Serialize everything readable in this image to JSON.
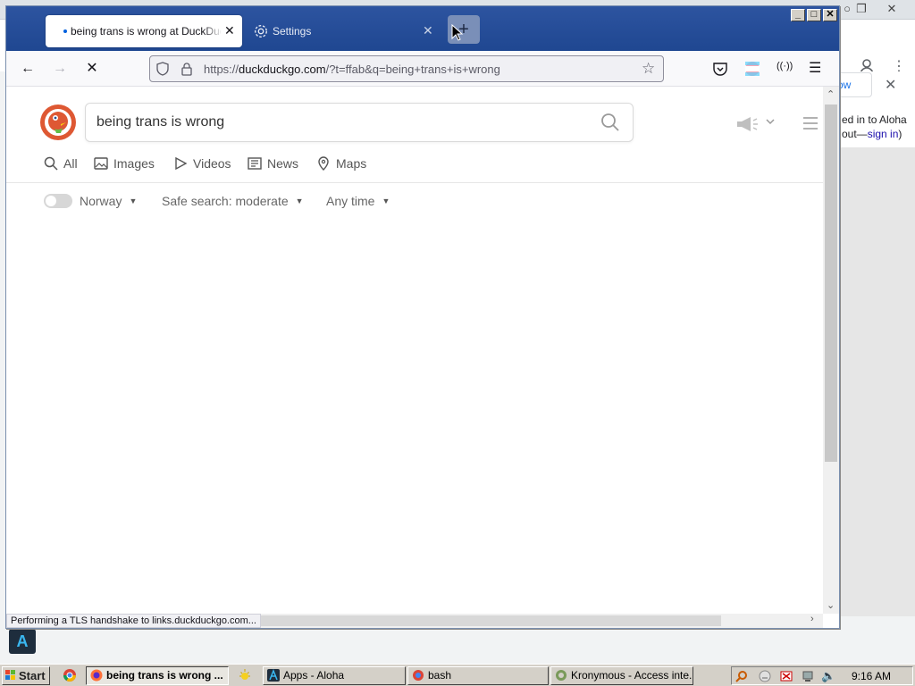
{
  "background_window": {
    "now_button": "ow",
    "note_line1": "ed in to Aloha",
    "note_line2_prefix": "out—",
    "note_line2_link": "sign in",
    "note_line2_suffix": ")"
  },
  "browser": {
    "tabs": [
      {
        "title": "being trans is wrong at DuckDuckGo",
        "active": true
      },
      {
        "title": "Settings",
        "active": false
      }
    ],
    "new_tab_icon": "plus-icon",
    "url": {
      "prefix": "https://",
      "host": "duckduckgo.com",
      "path": "/?t=ffab&q=being+trans+is+wrong"
    },
    "status_text": "Performing a TLS handshake to links.duckduckgo.com..."
  },
  "ddg": {
    "query": "being trans is wrong",
    "verticals": [
      "All",
      "Images",
      "Videos",
      "News",
      "Maps"
    ],
    "filters": {
      "region": "Norway",
      "safe_search": "Safe search: moderate",
      "time": "Any time"
    }
  },
  "taskbar": {
    "start": "Start",
    "buttons": [
      {
        "label": "being trans is wrong ...",
        "active": true
      },
      {
        "label": "Apps - Aloha",
        "active": false
      },
      {
        "label": "bash",
        "active": false
      },
      {
        "label": "Kronymous - Access inte...",
        "active": false
      }
    ],
    "clock": "9:16 AM"
  },
  "colors": {
    "titlebar": "#1f4791",
    "ddg_orange": "#de5833",
    "taskbar": "#d4d0c8"
  }
}
